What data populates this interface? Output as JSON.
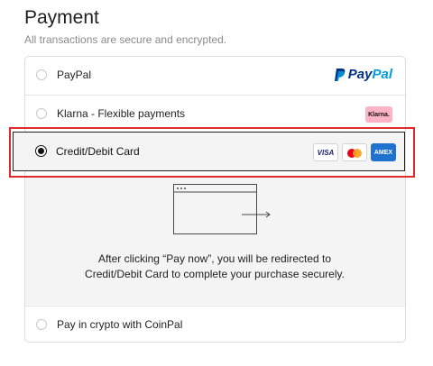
{
  "header": {
    "title": "Payment",
    "subtitle": "All transactions are secure and encrypted."
  },
  "options": [
    {
      "label": "PayPal",
      "selected": false,
      "logo_text": [
        "Pay",
        "Pal"
      ]
    },
    {
      "label": "Klarna - Flexible payments",
      "selected": false,
      "logo_text": "Klarna."
    },
    {
      "label": "Credit/Debit Card",
      "selected": true,
      "badges": [
        "VISA",
        "AMEX"
      ]
    },
    {
      "label": "Pay in crypto with CoinPal",
      "selected": false
    }
  ],
  "card_details": {
    "redirect_text": "After clicking “Pay now”, you will be redirected to Credit/Debit Card to complete your purchase securely."
  },
  "colors": {
    "highlight_outline": "#e02a2a",
    "paypal_dark": "#003087",
    "paypal_light": "#009cde",
    "klarna_pink": "#ffb3c7",
    "amex_blue": "#1f72cd"
  },
  "icons": [
    "paypal-logo-icon",
    "klarna-logo-icon",
    "visa-icon",
    "mastercard-icon",
    "amex-icon",
    "redirect-window-icon"
  ]
}
